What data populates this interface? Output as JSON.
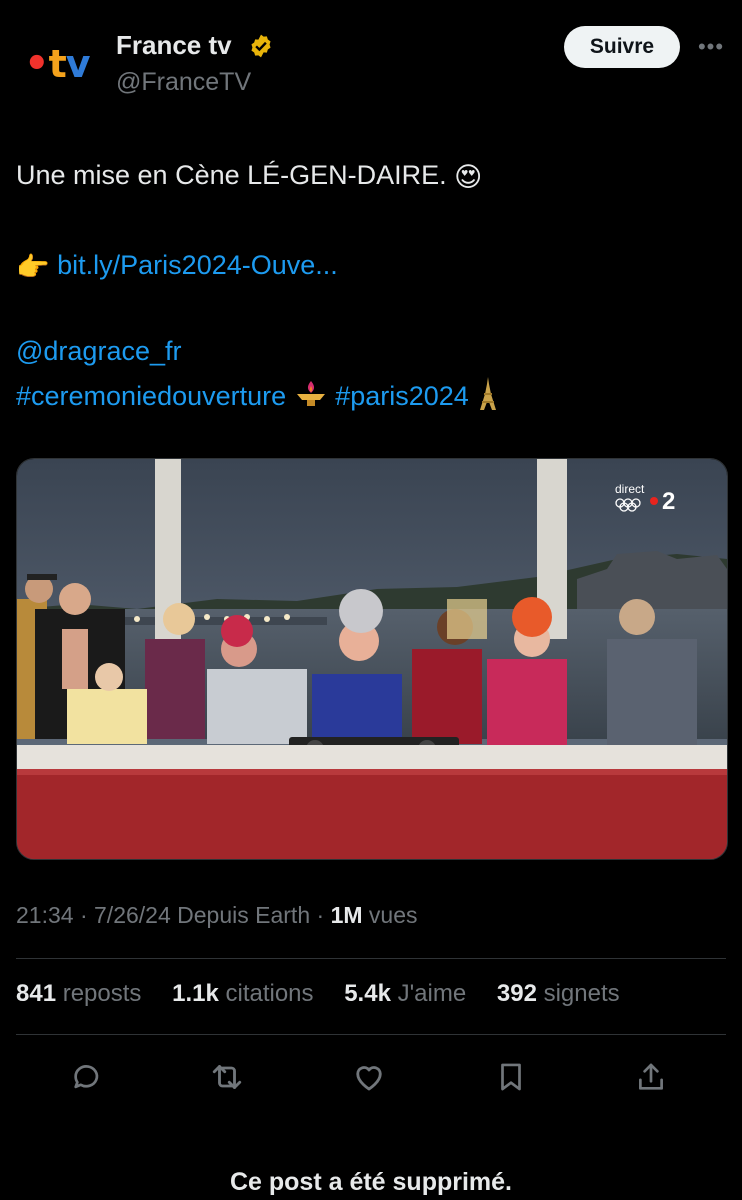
{
  "account": {
    "display_name": "France tv",
    "handle": "@FranceTV",
    "verified": true,
    "logo_text_dot": "•",
    "logo_text_t": "t",
    "logo_text_v": "v"
  },
  "header": {
    "follow_label": "Suivre",
    "more_label": "•••"
  },
  "tweet": {
    "line1_text": "Une mise en Cène LÉ-GEN-DAIRE.",
    "line1_emoji": "😍",
    "line2_emoji": "👉",
    "line2_link": "bit.ly/Paris2024-Ouve...",
    "mention": "@dragrace_fr",
    "hashtag1": "#ceremoniedouverture",
    "hashtag2": "#paris2024"
  },
  "media": {
    "broadcast_label": "direct",
    "channel_number": "2"
  },
  "meta": {
    "time": "21:34",
    "date": "7/26/24",
    "source": "Depuis Earth",
    "views_value": "1M",
    "views_label": "vues"
  },
  "stats": {
    "reposts_value": "841",
    "reposts_label": "reposts",
    "quotes_value": "1.1k",
    "quotes_label": "citations",
    "likes_value": "5.4k",
    "likes_label": "J'aime",
    "bookmarks_value": "392",
    "bookmarks_label": "signets"
  },
  "actions": [
    "reply-icon",
    "repost-icon",
    "like-icon",
    "bookmark-icon",
    "share-icon"
  ],
  "notice": "Ce post a été supprimé.",
  "colors": {
    "background": "#000000",
    "text": "#e7e9ea",
    "muted": "#71767b",
    "link": "#1d9bf0",
    "verified": "#e8b40a"
  }
}
